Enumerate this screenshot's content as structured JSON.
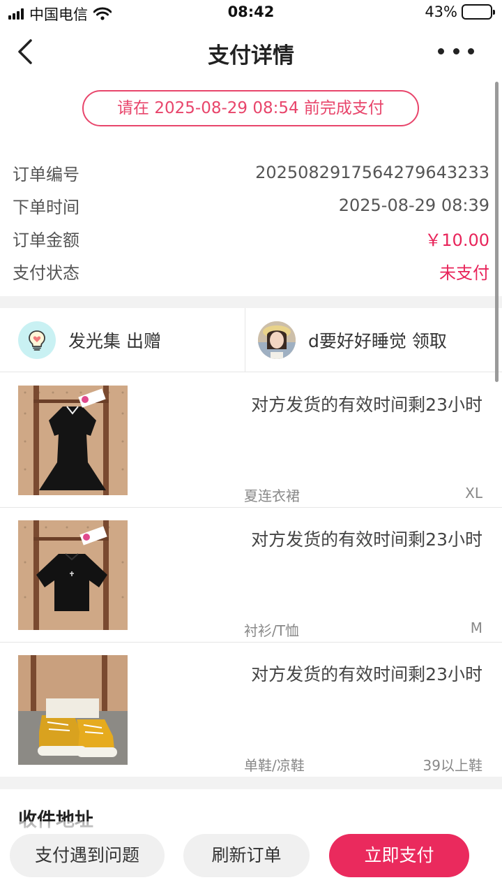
{
  "status_bar": {
    "carrier": "中国电信",
    "time": "08:42",
    "battery_percent": "43%",
    "battery_level": 0.43
  },
  "header": {
    "title": "支付详情",
    "back_icon": "chevron-left-icon",
    "more_icon": "more-dots-icon"
  },
  "deadline_notice": "请在 2025-08-29 08:54 前完成支付",
  "order_info": [
    {
      "label": "订单编号",
      "value": "20250829175642796432 33"
    },
    {
      "label": "下单时间",
      "value": "2025-08-29 08:39"
    },
    {
      "label": "订单金额",
      "value": "￥10.00"
    },
    {
      "label": "支付状态",
      "value": "未支付"
    }
  ],
  "parties": {
    "giver": {
      "name": "发光集 出赠",
      "icon": "lightbulb-heart-icon"
    },
    "receiver": {
      "name": "d要好好睡觉 领取",
      "icon": "user-avatar"
    }
  },
  "items": [
    {
      "deadline": "对方发货的有效时间剩23小时",
      "category": "夏连衣裙",
      "size": "XL"
    },
    {
      "deadline": "对方发货的有效时间剩23小时",
      "category": "衬衫/T恤",
      "size": "M"
    },
    {
      "deadline": "对方发货的有效时间剩23小时",
      "category": "单鞋/凉鞋",
      "size": "39以上鞋"
    }
  ],
  "address": {
    "title": "收件地址"
  },
  "actions": {
    "problem": "支付遇到问题",
    "refresh": "刷新订单",
    "pay": "立即支付"
  },
  "colors": {
    "accent": "#ea2a5d",
    "notice": "#e8456b"
  }
}
